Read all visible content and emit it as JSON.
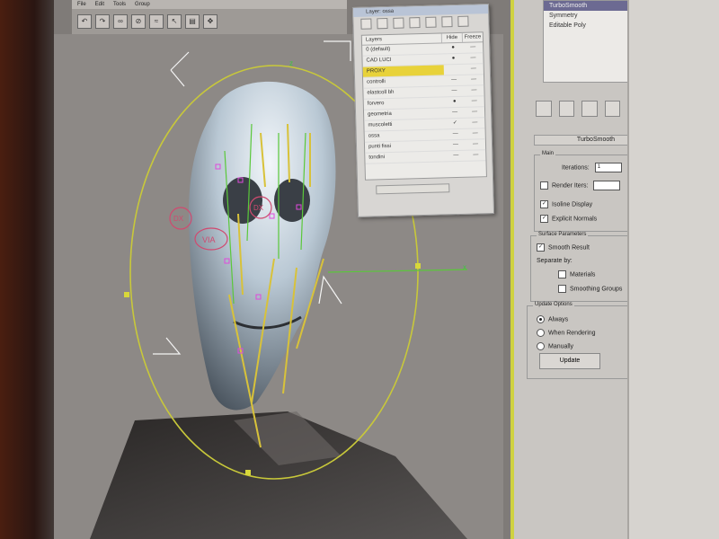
{
  "menu": {
    "items": [
      "File",
      "Edit",
      "Tools",
      "Group"
    ]
  },
  "toolbar": {
    "icons": [
      "undo-icon",
      "redo-icon",
      "link-icon",
      "unlink-icon",
      "bind-icon",
      "select-icon",
      "filter-icon",
      "move-icon"
    ]
  },
  "layer_window": {
    "title": "Layer: ossa",
    "columns": {
      "layers": "Layers",
      "hide": "Hide",
      "freeze": "Freeze"
    },
    "rows": [
      {
        "name": "0 (default)",
        "hide": "●",
        "freeze": "—"
      },
      {
        "name": "CAD LUCI",
        "hide": "●",
        "freeze": "—"
      },
      {
        "name": "PROXY",
        "hide": "",
        "freeze": "—"
      },
      {
        "name": "controlli",
        "hide": "—",
        "freeze": "—"
      },
      {
        "name": "elastcoll bh",
        "hide": "—",
        "freeze": "—"
      },
      {
        "name": "forvero",
        "hide": "●",
        "freeze": "—"
      },
      {
        "name": "geometria",
        "hide": "—",
        "freeze": "—"
      },
      {
        "name": "muscoletti",
        "hide": "✓",
        "freeze": "—"
      },
      {
        "name": "ossa",
        "hide": "—",
        "freeze": "—"
      },
      {
        "name": "punti fissi",
        "hide": "—",
        "freeze": "—"
      },
      {
        "name": "tondini",
        "hide": "—",
        "freeze": "—"
      }
    ]
  },
  "modifier_stack": {
    "items": [
      "TurboSmooth",
      "Symmetry",
      "Editable Poly"
    ],
    "highlight_index": 0
  },
  "turbosmooth": {
    "title": "TurboSmooth",
    "main": {
      "label": "Main",
      "iterations_label": "Iterations:",
      "iterations_value": "1",
      "render_iters_label": "Render Iters:",
      "render_iters_value": "",
      "isoline_label": "Isoline Display",
      "explicit_normals_label": "Explicit Normals"
    },
    "surface": {
      "label": "Surface Parameters",
      "smooth_result_label": "Smooth Result",
      "separate_by_label": "Separate by:",
      "materials_label": "Materials",
      "smoothing_groups_label": "Smoothing Groups"
    },
    "update": {
      "label": "Update Options",
      "always_label": "Always",
      "when_rendering_label": "When Rendering",
      "manually_label": "Manually",
      "button_label": "Update"
    }
  },
  "viewport_labels": {
    "left": "DX",
    "mid": "DX",
    "logo": "VIA"
  },
  "colors": {
    "highlight": "#e8d23a",
    "accent_yellow": "#cfd240",
    "gizmo_green": "#3ec63e"
  }
}
